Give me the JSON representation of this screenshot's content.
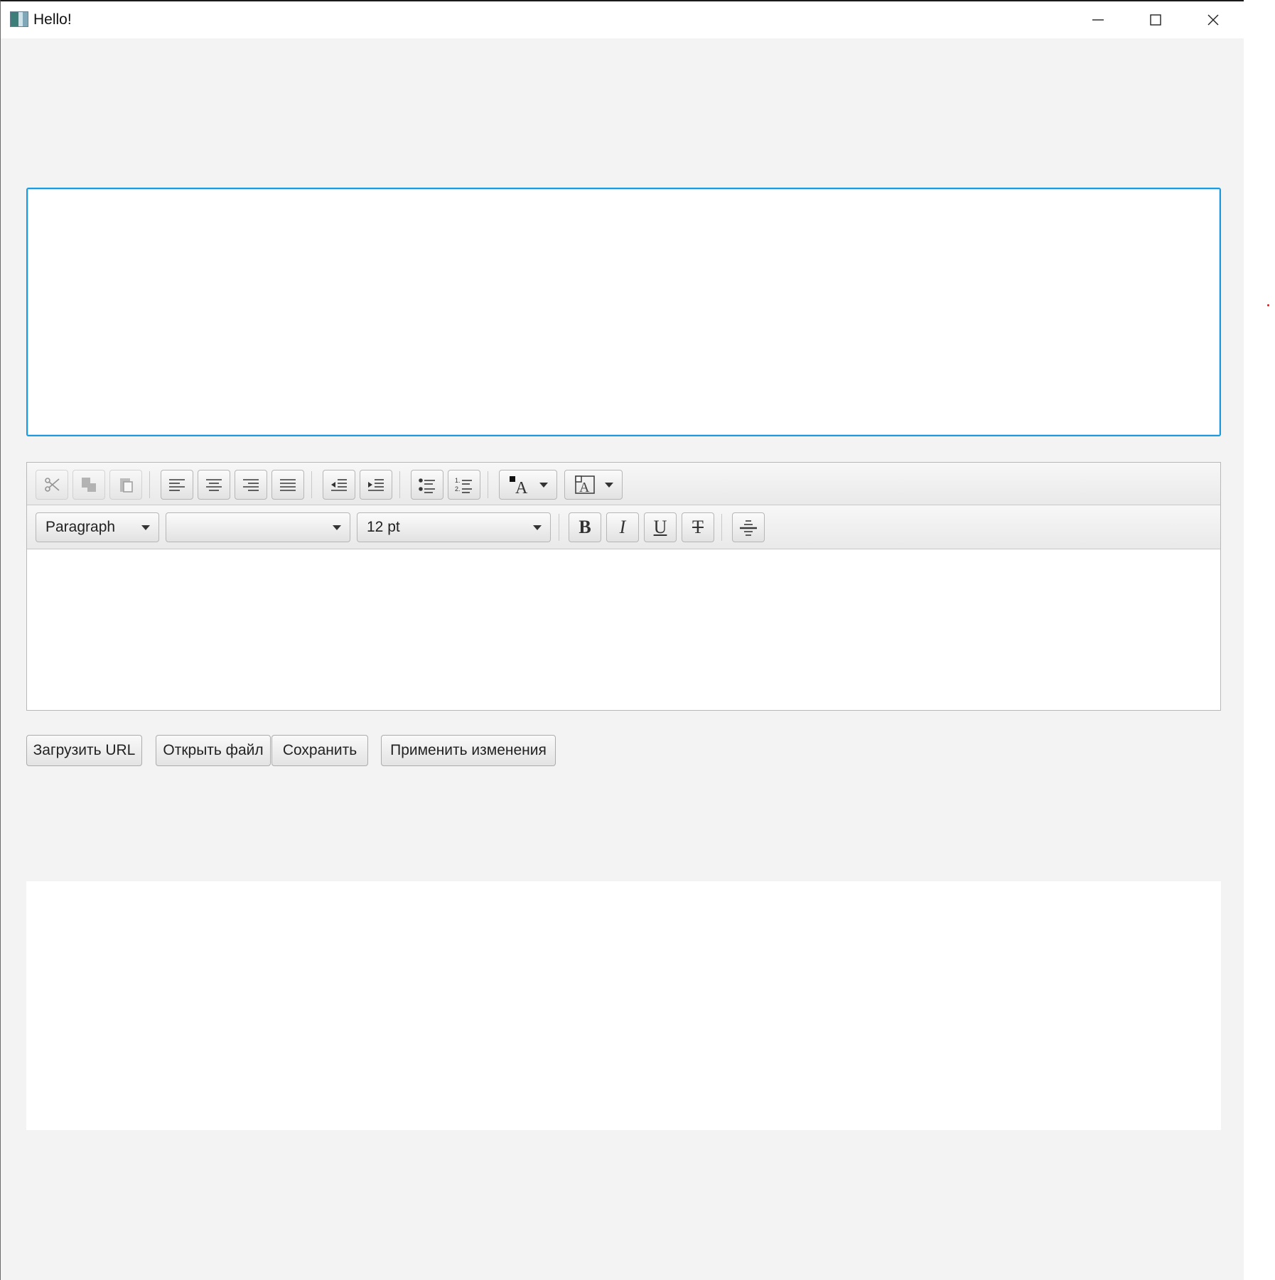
{
  "window": {
    "title": "Hello!",
    "controls": {
      "minimize": "minimize-icon",
      "maximize": "maximize-icon",
      "close": "close-icon"
    }
  },
  "text_area": {
    "value": ""
  },
  "html_editor": {
    "toolbar_top": {
      "buttons": [
        "cut-icon",
        "copy-icon",
        "paste-icon",
        "align-left-icon",
        "align-center-icon",
        "align-right-icon",
        "align-justify-icon",
        "outdent-icon",
        "indent-icon",
        "bullets-icon",
        "numbers-icon",
        "text-color-icon",
        "background-color-icon"
      ]
    },
    "toolbar_bottom": {
      "paragraph_format": "Paragraph",
      "font_family": "",
      "font_size": "12 pt",
      "bold_label": "B",
      "italic_label": "I",
      "underline_label": "U",
      "strikethrough_label": "T"
    },
    "content": ""
  },
  "actions": {
    "load_url": "Загрузить URL",
    "open_file": "Открыть файл",
    "save": "Сохранить",
    "apply": "Применить изменения"
  }
}
